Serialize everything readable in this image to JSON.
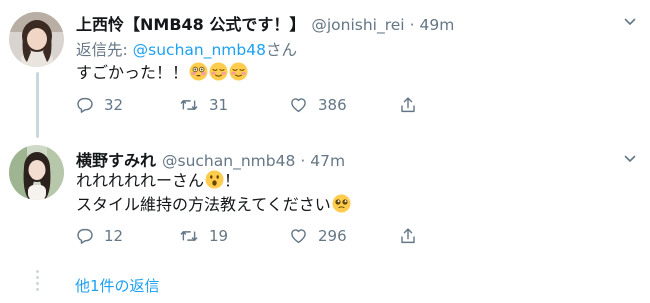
{
  "colors": {
    "link": "#1da1f2",
    "secondary_text": "#657786",
    "thread_line": "#ccd6dd"
  },
  "tweets": [
    {
      "name": "上西怜【NMB48 公式です！】",
      "handle": "@jonishi_rei",
      "separator": "·",
      "time": "49m",
      "reply_to_prefix": "返信先: ",
      "reply_to_handle": "@suchan_nmb48",
      "reply_to_suffix": "さん",
      "text": "すごかった！！",
      "emojis": [
        "flushed-face-emoji",
        "relieved-face-emoji",
        "relieved-face-emoji"
      ],
      "replies": "32",
      "retweets": "31",
      "likes": "386"
    },
    {
      "name": "横野すみれ",
      "handle": "@suchan_nmb48",
      "separator": "·",
      "time": "47m",
      "text_line1": "れれれれれーさん",
      "text_line1_emoji": "astonished-face-emoji",
      "text_line1_suffix": "！",
      "text_line2": "スタイル維持の方法教えてください",
      "text_line2_emoji": "pleading-face-emoji",
      "replies": "12",
      "retweets": "19",
      "likes": "296"
    }
  ],
  "more_replies": "他1件の返信"
}
